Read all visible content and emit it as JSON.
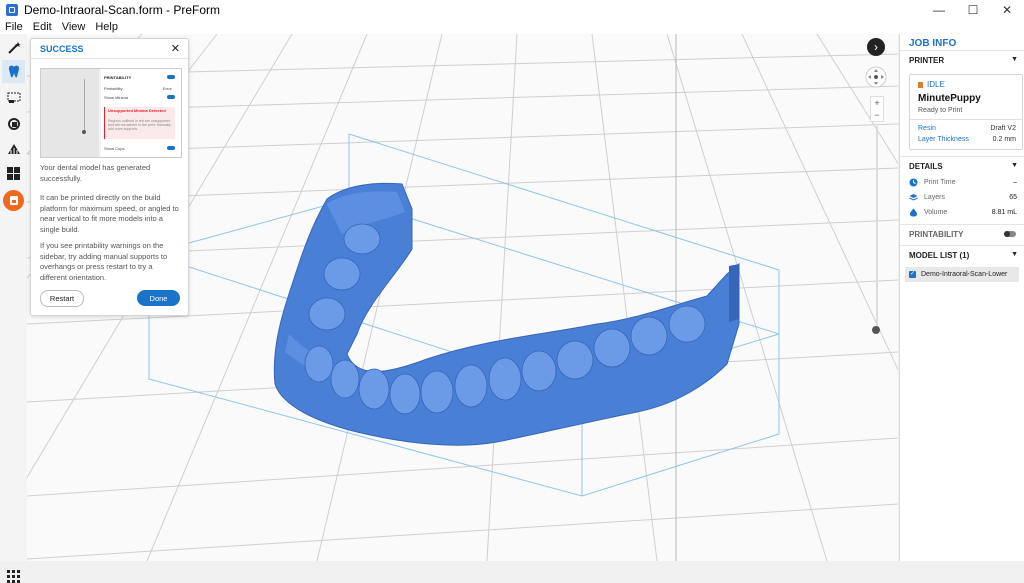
{
  "window": {
    "title": "Demo-Intraoral-Scan.form - PreForm",
    "minimize": "—",
    "maximize": "☐",
    "close": "✕"
  },
  "menu": [
    {
      "label": "File"
    },
    {
      "label": "Edit"
    },
    {
      "label": "View"
    },
    {
      "label": "Help"
    }
  ],
  "toolbar": {
    "tools": [
      "magic-wand-icon",
      "tooth-icon",
      "select-box-icon",
      "orient-icon",
      "supports-icon",
      "layout-icon",
      "print-icon"
    ],
    "active_tool": "tooth-icon",
    "bottom_icon": "apps-grid-icon"
  },
  "viewport": {
    "expand_button": "›",
    "zoom_in": "+",
    "zoom_out": "−",
    "model_color": "#4a7fd6",
    "layer_slider_fraction": 0.02
  },
  "dialog": {
    "title": "SUCCESS",
    "close": "✕",
    "paragraphs": [
      "Your dental model has generated successfully.",
      "It can be printed directly on the build platform for maximum speed, or angled to near vertical to fit more models into a single build.",
      "If you see printability warnings on the sidebar, try adding manual supports to overhangs or press restart to try a different orientation."
    ],
    "restart_label": "Restart",
    "done_label": "Done",
    "thumbnail": {
      "heading": "PRINTABILITY",
      "row1_label": "Printability",
      "row1_value": "Error",
      "row2_label": "Show Minima",
      "warning_title": "Unsupported Minima Detected",
      "warning_body": "Regions outlined in red are unsupported and will not adhere to the print. Manually add more supports.",
      "row3_label": "Show Cups"
    }
  },
  "sidebar": {
    "title": "JOB INFO",
    "printer": {
      "section": "PRINTER",
      "status": "IDLE",
      "name": "MinutePuppy",
      "state": "Ready to Print",
      "resin_label": "Resin",
      "resin_value": "Draft V2",
      "layer_label": "Layer Thickness",
      "layer_value": "0.2 mm"
    },
    "details": {
      "section": "DETAILS",
      "rows": [
        {
          "icon": "clock-icon",
          "label": "Print Time",
          "value": "–"
        },
        {
          "icon": "layers-icon",
          "label": "Layers",
          "value": "65"
        },
        {
          "icon": "volume-icon",
          "label": "Volume",
          "value": "8.81 mL"
        }
      ]
    },
    "printability": {
      "section": "PRINTABILITY",
      "enabled": false
    },
    "model_list": {
      "section": "MODEL LIST (1)",
      "items": [
        "Demo-Intraoral-Scan-Lower"
      ]
    }
  }
}
